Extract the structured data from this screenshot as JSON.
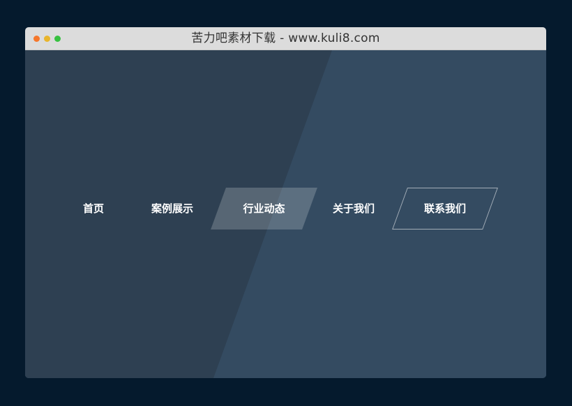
{
  "window": {
    "title": "苦力吧素材下载 - www.kuli8.com"
  },
  "colors": {
    "page_background": "#051a2d",
    "titlebar": "#dcdcdc",
    "stage_light": "#344b61",
    "stage_dark": "#2e4052",
    "dot_red": "#f5772b",
    "dot_yellow": "#e9b52c",
    "dot_green": "#37c140"
  },
  "nav": {
    "items": [
      {
        "label": "首页",
        "state": "normal"
      },
      {
        "label": "案例展示",
        "state": "normal"
      },
      {
        "label": "行业动态",
        "state": "active"
      },
      {
        "label": "关于我们",
        "state": "normal"
      },
      {
        "label": "联系我们",
        "state": "outlined"
      }
    ]
  }
}
